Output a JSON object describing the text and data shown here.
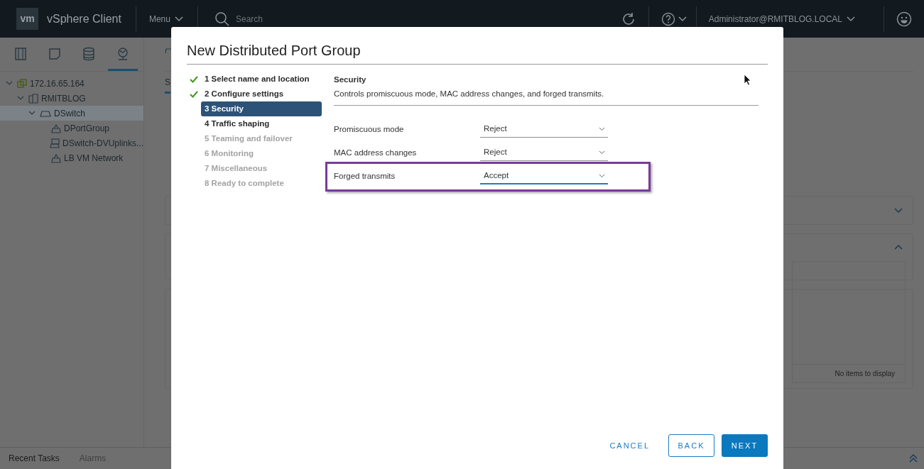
{
  "header": {
    "logo": "vm",
    "app_title": "vSphere Client",
    "menu": "Menu",
    "search": {
      "placeholder": "Search"
    },
    "user": "Administrator@RMITBLOG.LOCAL"
  },
  "nav_tabs": [
    {
      "kind": "hosts",
      "selected": false
    },
    {
      "kind": "vms",
      "selected": false
    },
    {
      "kind": "storage",
      "selected": false
    },
    {
      "kind": "network",
      "selected": true
    }
  ],
  "tree": [
    {
      "label": "172.16.65.164",
      "kind": "vcenter",
      "expanded": true,
      "selected": false,
      "children": [
        {
          "label": "RMITBLOG",
          "kind": "datacenter",
          "expanded": true,
          "selected": false,
          "children": [
            {
              "label": "DSwitch",
              "kind": "switch",
              "expanded": true,
              "selected": true,
              "children": [
                {
                  "label": "DPortGroup",
                  "kind": "portgroup",
                  "selected": false
                },
                {
                  "label": "DSwitch-DVUplinks...",
                  "kind": "uplinks",
                  "selected": false
                },
                {
                  "label": "LB VM Network",
                  "kind": "portgroup",
                  "selected": false
                }
              ]
            }
          ]
        }
      ]
    }
  ],
  "main": {
    "tab": "S",
    "table_empty": "No items to display"
  },
  "bottom_tabs": [
    {
      "label": "Recent Tasks",
      "selected": true
    },
    {
      "label": "Alarms",
      "selected": false
    }
  ],
  "dialog": {
    "title": "New Distributed Port Group",
    "steps": [
      {
        "label": "1 Select name and location",
        "completed": true,
        "selected": false,
        "disabled": false
      },
      {
        "label": "2 Configure settings",
        "completed": true,
        "selected": false,
        "disabled": false
      },
      {
        "label": "3 Security",
        "completed": false,
        "selected": true,
        "disabled": false
      },
      {
        "label": "4 Traffic shaping",
        "completed": false,
        "selected": false,
        "disabled": false
      },
      {
        "label": "5 Teaming and failover",
        "completed": false,
        "selected": false,
        "disabled": true
      },
      {
        "label": "6 Monitoring",
        "completed": false,
        "selected": false,
        "disabled": true
      },
      {
        "label": "7 Miscellaneous",
        "completed": false,
        "selected": false,
        "disabled": true
      },
      {
        "label": "8 Ready to complete",
        "completed": false,
        "selected": false,
        "disabled": true
      }
    ],
    "section_title": "Security",
    "section_description": "Controls promiscuous mode, MAC address changes, and forged transmits.",
    "fields": [
      {
        "label": "Promiscuous mode",
        "value": "Reject",
        "focused": false,
        "highlighted": false
      },
      {
        "label": "MAC address changes",
        "value": "Reject",
        "focused": false,
        "highlighted": false
      },
      {
        "label": "Forged transmits",
        "value": "Accept",
        "focused": true,
        "highlighted": true
      }
    ],
    "buttons": [
      {
        "label": "CANCEL",
        "kind": "flat"
      },
      {
        "label": "BACK",
        "kind": "outline"
      },
      {
        "label": "NEXT",
        "kind": "primary"
      }
    ]
  }
}
